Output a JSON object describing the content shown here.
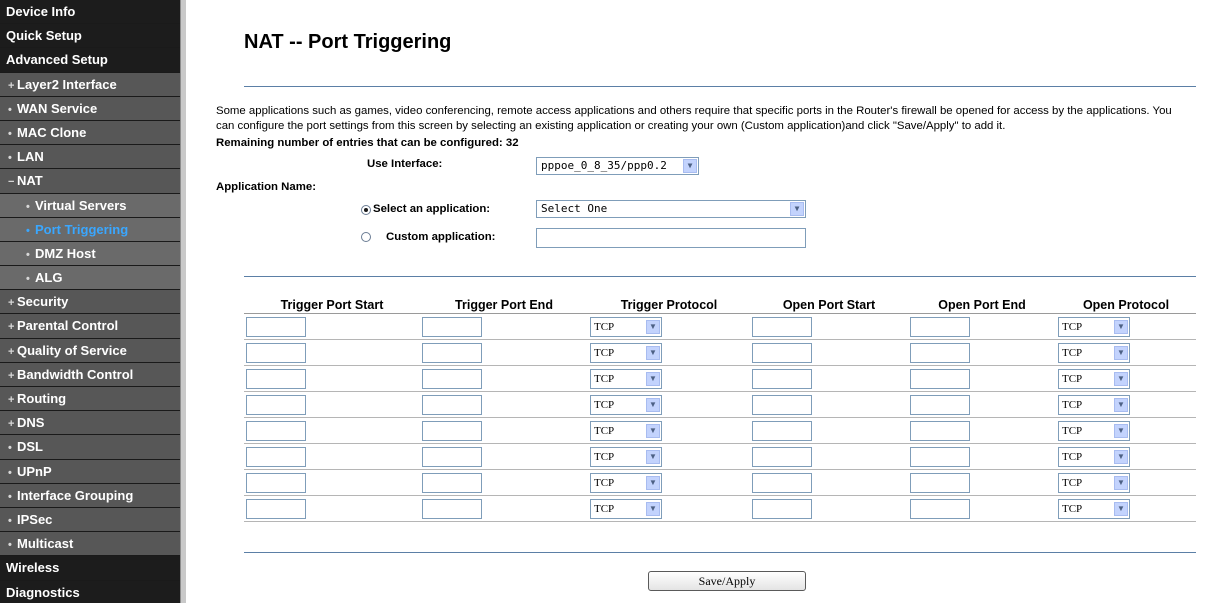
{
  "sidebar": {
    "items": [
      {
        "label": "Device Info",
        "level": "top"
      },
      {
        "label": "Quick Setup",
        "level": "top"
      },
      {
        "label": "Advanced Setup",
        "level": "top"
      },
      {
        "label": "Layer2 Interface",
        "level": "sub",
        "bullet": "+"
      },
      {
        "label": "WAN Service",
        "level": "sub",
        "bullet": "•"
      },
      {
        "label": "MAC Clone",
        "level": "sub",
        "bullet": "•"
      },
      {
        "label": "LAN",
        "level": "sub",
        "bullet": "•"
      },
      {
        "label": "NAT",
        "level": "sub",
        "bullet": "−"
      },
      {
        "label": "Virtual Servers",
        "level": "subsub",
        "bullet": "•"
      },
      {
        "label": "Port Triggering",
        "level": "subsub",
        "bullet": "•",
        "active": true
      },
      {
        "label": "DMZ Host",
        "level": "subsub",
        "bullet": "•"
      },
      {
        "label": "ALG",
        "level": "subsub",
        "bullet": "•"
      },
      {
        "label": "Security",
        "level": "sub",
        "bullet": "+"
      },
      {
        "label": "Parental Control",
        "level": "sub",
        "bullet": "+"
      },
      {
        "label": "Quality of Service",
        "level": "sub",
        "bullet": "+"
      },
      {
        "label": "Bandwidth Control",
        "level": "sub",
        "bullet": "+"
      },
      {
        "label": "Routing",
        "level": "sub",
        "bullet": "+"
      },
      {
        "label": "DNS",
        "level": "sub",
        "bullet": "+"
      },
      {
        "label": "DSL",
        "level": "sub",
        "bullet": "•"
      },
      {
        "label": "UPnP",
        "level": "sub",
        "bullet": "•"
      },
      {
        "label": "Interface Grouping",
        "level": "sub",
        "bullet": "•"
      },
      {
        "label": "IPSec",
        "level": "sub",
        "bullet": "•"
      },
      {
        "label": "Multicast",
        "level": "sub",
        "bullet": "•"
      },
      {
        "label": "Wireless",
        "level": "top"
      },
      {
        "label": "Diagnostics",
        "level": "top"
      }
    ]
  },
  "main": {
    "title": "NAT -- Port Triggering",
    "description": "Some applications such as games, video conferencing, remote access applications and others require that specific ports in the Router's firewall be opened for access by the applications. You can configure the port settings from this screen by selecting an existing application or creating your own (Custom application)and click \"Save/Apply\" to add it.",
    "remaining_label": "Remaining number of entries that can be configured:",
    "remaining_count": "32",
    "use_interface_label": "Use Interface:",
    "use_interface_value": "pppoe_0_8_35/ppp0.2",
    "application_name_label": "Application Name:",
    "select_app_label": "Select an application:",
    "select_app_value": "Select One",
    "custom_app_label": "Custom application:",
    "custom_app_value": "",
    "save_label": "Save/Apply"
  },
  "table": {
    "headers": [
      "Trigger Port Start",
      "Trigger Port End",
      "Trigger Protocol",
      "Open Port Start",
      "Open Port End",
      "Open Protocol"
    ],
    "rows": [
      {
        "trigger_protocol": "TCP",
        "open_protocol": "TCP"
      },
      {
        "trigger_protocol": "TCP",
        "open_protocol": "TCP"
      },
      {
        "trigger_protocol": "TCP",
        "open_protocol": "TCP"
      },
      {
        "trigger_protocol": "TCP",
        "open_protocol": "TCP"
      },
      {
        "trigger_protocol": "TCP",
        "open_protocol": "TCP"
      },
      {
        "trigger_protocol": "TCP",
        "open_protocol": "TCP"
      },
      {
        "trigger_protocol": "TCP",
        "open_protocol": "TCP"
      },
      {
        "trigger_protocol": "TCP",
        "open_protocol": "TCP"
      }
    ]
  },
  "colors": {
    "sidebar_bg": "#2b2b2b",
    "active_link": "#3aa7ff",
    "divider": "#5b7fa6"
  }
}
